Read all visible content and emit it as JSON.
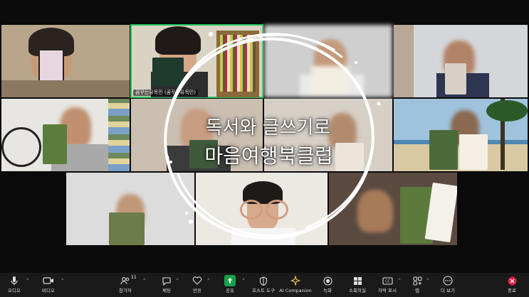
{
  "overlay": {
    "line1": "독서와 글쓰기로",
    "line2": "마음여행북클럽"
  },
  "tiles": [
    {
      "name": ""
    },
    {
      "name": "꿈꾸는유목민 (꿈꾸는유목민)"
    },
    {
      "name": ""
    },
    {
      "name": ""
    },
    {
      "name": ""
    },
    {
      "name": ""
    },
    {
      "name": ""
    },
    {
      "name": ""
    },
    {
      "name": ""
    },
    {
      "name": ""
    },
    {
      "name": ""
    }
  ],
  "toolbar": {
    "audio_label": "오디오",
    "video_label": "비디오",
    "participants_label": "참가자",
    "participants_count": "11",
    "chat_label": "채팅",
    "react_label": "반응",
    "share_label": "공유",
    "host_tools_label": "호스트 도구",
    "ai_label": "AI Companion",
    "record_label": "녹화",
    "breakout_label": "소회의실",
    "captions_label": "자막 표시",
    "apps_label": "앱",
    "more_label": "더 보기",
    "end_label": "종료"
  },
  "colors": {
    "toolbar_bg": "#1a1a1a",
    "active_speaker": "#22c55e",
    "share_green": "#16a34a",
    "end_red": "#e11d48"
  }
}
